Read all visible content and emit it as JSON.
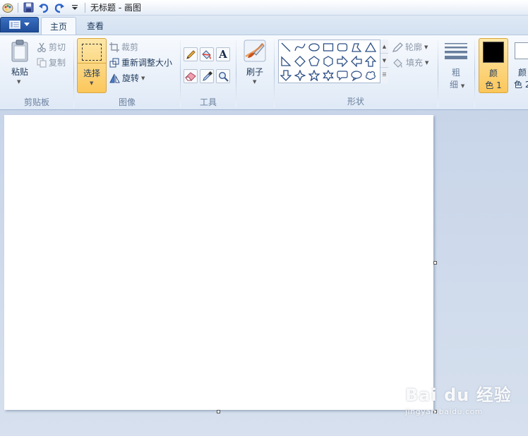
{
  "window": {
    "title": "无标题 - 画图"
  },
  "tabs": [
    {
      "label": "主页",
      "active": true
    },
    {
      "label": "查看",
      "active": false
    }
  ],
  "ribbon": {
    "clipboard": {
      "group_label": "剪贴板",
      "paste": "粘贴",
      "cut": "剪切",
      "copy": "复制"
    },
    "image": {
      "group_label": "图像",
      "select": "选择",
      "crop": "裁剪",
      "resize": "重新调整大小",
      "rotate": "旋转"
    },
    "tools": {
      "group_label": "工具",
      "text_glyph": "A"
    },
    "brushes": {
      "label": "刷子"
    },
    "shapes": {
      "group_label": "形状",
      "outline": "轮廓",
      "fill": "填充"
    },
    "size": {
      "label_line1": "粗",
      "label_line2": "细"
    },
    "colors": {
      "color1_line1": "颜",
      "color1_line2": "色 1",
      "color2_line1": "颜",
      "color2_line2": "色 2",
      "color1_value": "#000000",
      "color2_value": "#ffffff"
    }
  },
  "watermark": {
    "main": "Bai du 经验",
    "sub": "jingyan.baidu.com"
  },
  "theme": {
    "accent": "#fbd27a",
    "app_button": "#2b5cae"
  }
}
